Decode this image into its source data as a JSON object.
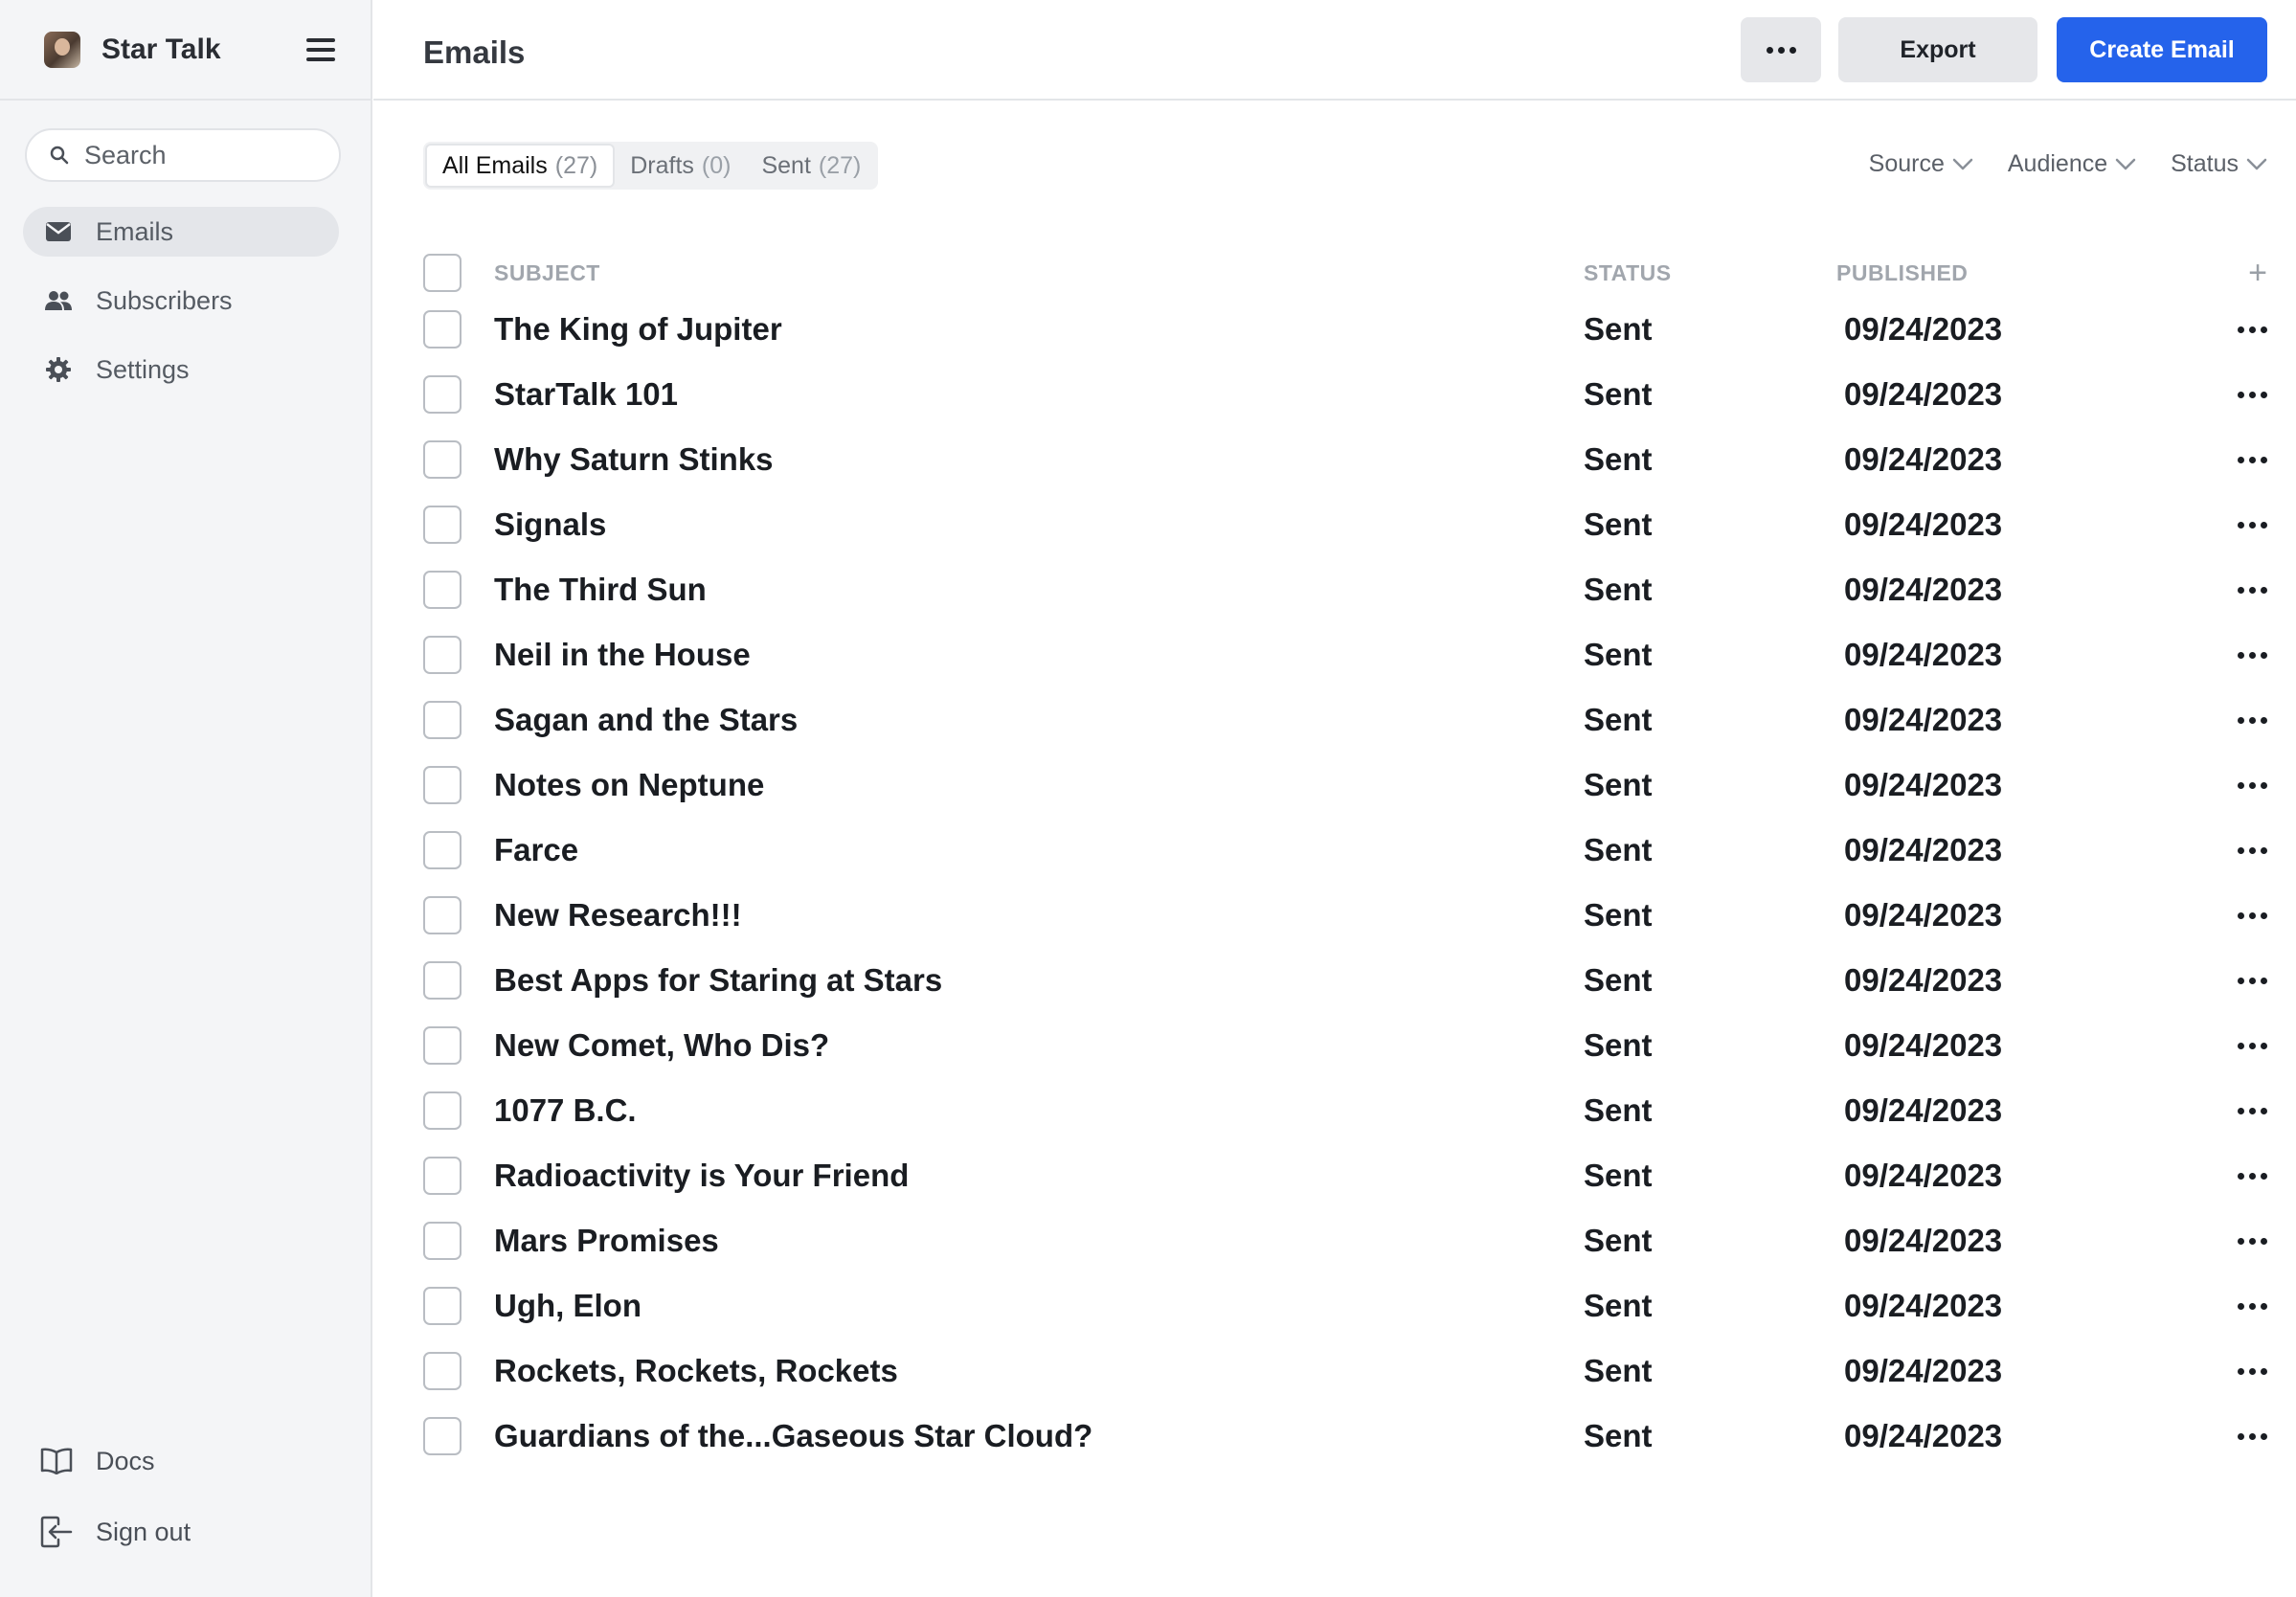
{
  "app": {
    "name": "Star Talk"
  },
  "sidebar": {
    "search_placeholder": "Search",
    "items": [
      {
        "label": "Emails",
        "icon": "mail-icon",
        "active": true
      },
      {
        "label": "Subscribers",
        "icon": "users-icon",
        "active": false
      },
      {
        "label": "Settings",
        "icon": "gear-icon",
        "active": false
      }
    ],
    "bottom": [
      {
        "label": "Docs",
        "icon": "book-icon"
      },
      {
        "label": "Sign out",
        "icon": "sign-out-icon"
      }
    ]
  },
  "header": {
    "title": "Emails",
    "export_label": "Export",
    "create_label": "Create Email"
  },
  "tabs": [
    {
      "label": "All Emails",
      "count": "(27)",
      "active": true
    },
    {
      "label": "Drafts",
      "count": "(0)",
      "active": false
    },
    {
      "label": "Sent",
      "count": "(27)",
      "active": false
    }
  ],
  "filters": [
    "Source",
    "Audience",
    "Status"
  ],
  "table": {
    "columns": {
      "subject": "SUBJECT",
      "status": "STATUS",
      "published": "PUBLISHED"
    },
    "rows": [
      {
        "subject": "The King of Jupiter",
        "status": "Sent",
        "published": "09/24/2023"
      },
      {
        "subject": "StarTalk 101",
        "status": "Sent",
        "published": "09/24/2023"
      },
      {
        "subject": "Why Saturn Stinks",
        "status": "Sent",
        "published": "09/24/2023"
      },
      {
        "subject": "Signals",
        "status": "Sent",
        "published": "09/24/2023"
      },
      {
        "subject": "The Third Sun",
        "status": "Sent",
        "published": "09/24/2023"
      },
      {
        "subject": "Neil in the House",
        "status": "Sent",
        "published": "09/24/2023"
      },
      {
        "subject": "Sagan and the Stars",
        "status": "Sent",
        "published": "09/24/2023"
      },
      {
        "subject": "Notes on Neptune",
        "status": "Sent",
        "published": "09/24/2023"
      },
      {
        "subject": "Farce",
        "status": "Sent",
        "published": "09/24/2023"
      },
      {
        "subject": "New Research!!!",
        "status": "Sent",
        "published": "09/24/2023"
      },
      {
        "subject": "Best Apps for Staring at Stars",
        "status": "Sent",
        "published": "09/24/2023"
      },
      {
        "subject": "New Comet, Who Dis?",
        "status": "Sent",
        "published": "09/24/2023"
      },
      {
        "subject": "1077 B.C.",
        "status": "Sent",
        "published": "09/24/2023"
      },
      {
        "subject": "Radioactivity is Your Friend",
        "status": "Sent",
        "published": "09/24/2023"
      },
      {
        "subject": "Mars Promises",
        "status": "Sent",
        "published": "09/24/2023"
      },
      {
        "subject": "Ugh, Elon",
        "status": "Sent",
        "published": "09/24/2023"
      },
      {
        "subject": "Rockets, Rockets, Rockets",
        "status": "Sent",
        "published": "09/24/2023"
      },
      {
        "subject": "Guardians of the...Gaseous Star Cloud?",
        "status": "Sent",
        "published": "09/24/2023"
      }
    ]
  },
  "colors": {
    "accent": "#2563eb",
    "sidebar_bg": "#f4f5f7"
  }
}
